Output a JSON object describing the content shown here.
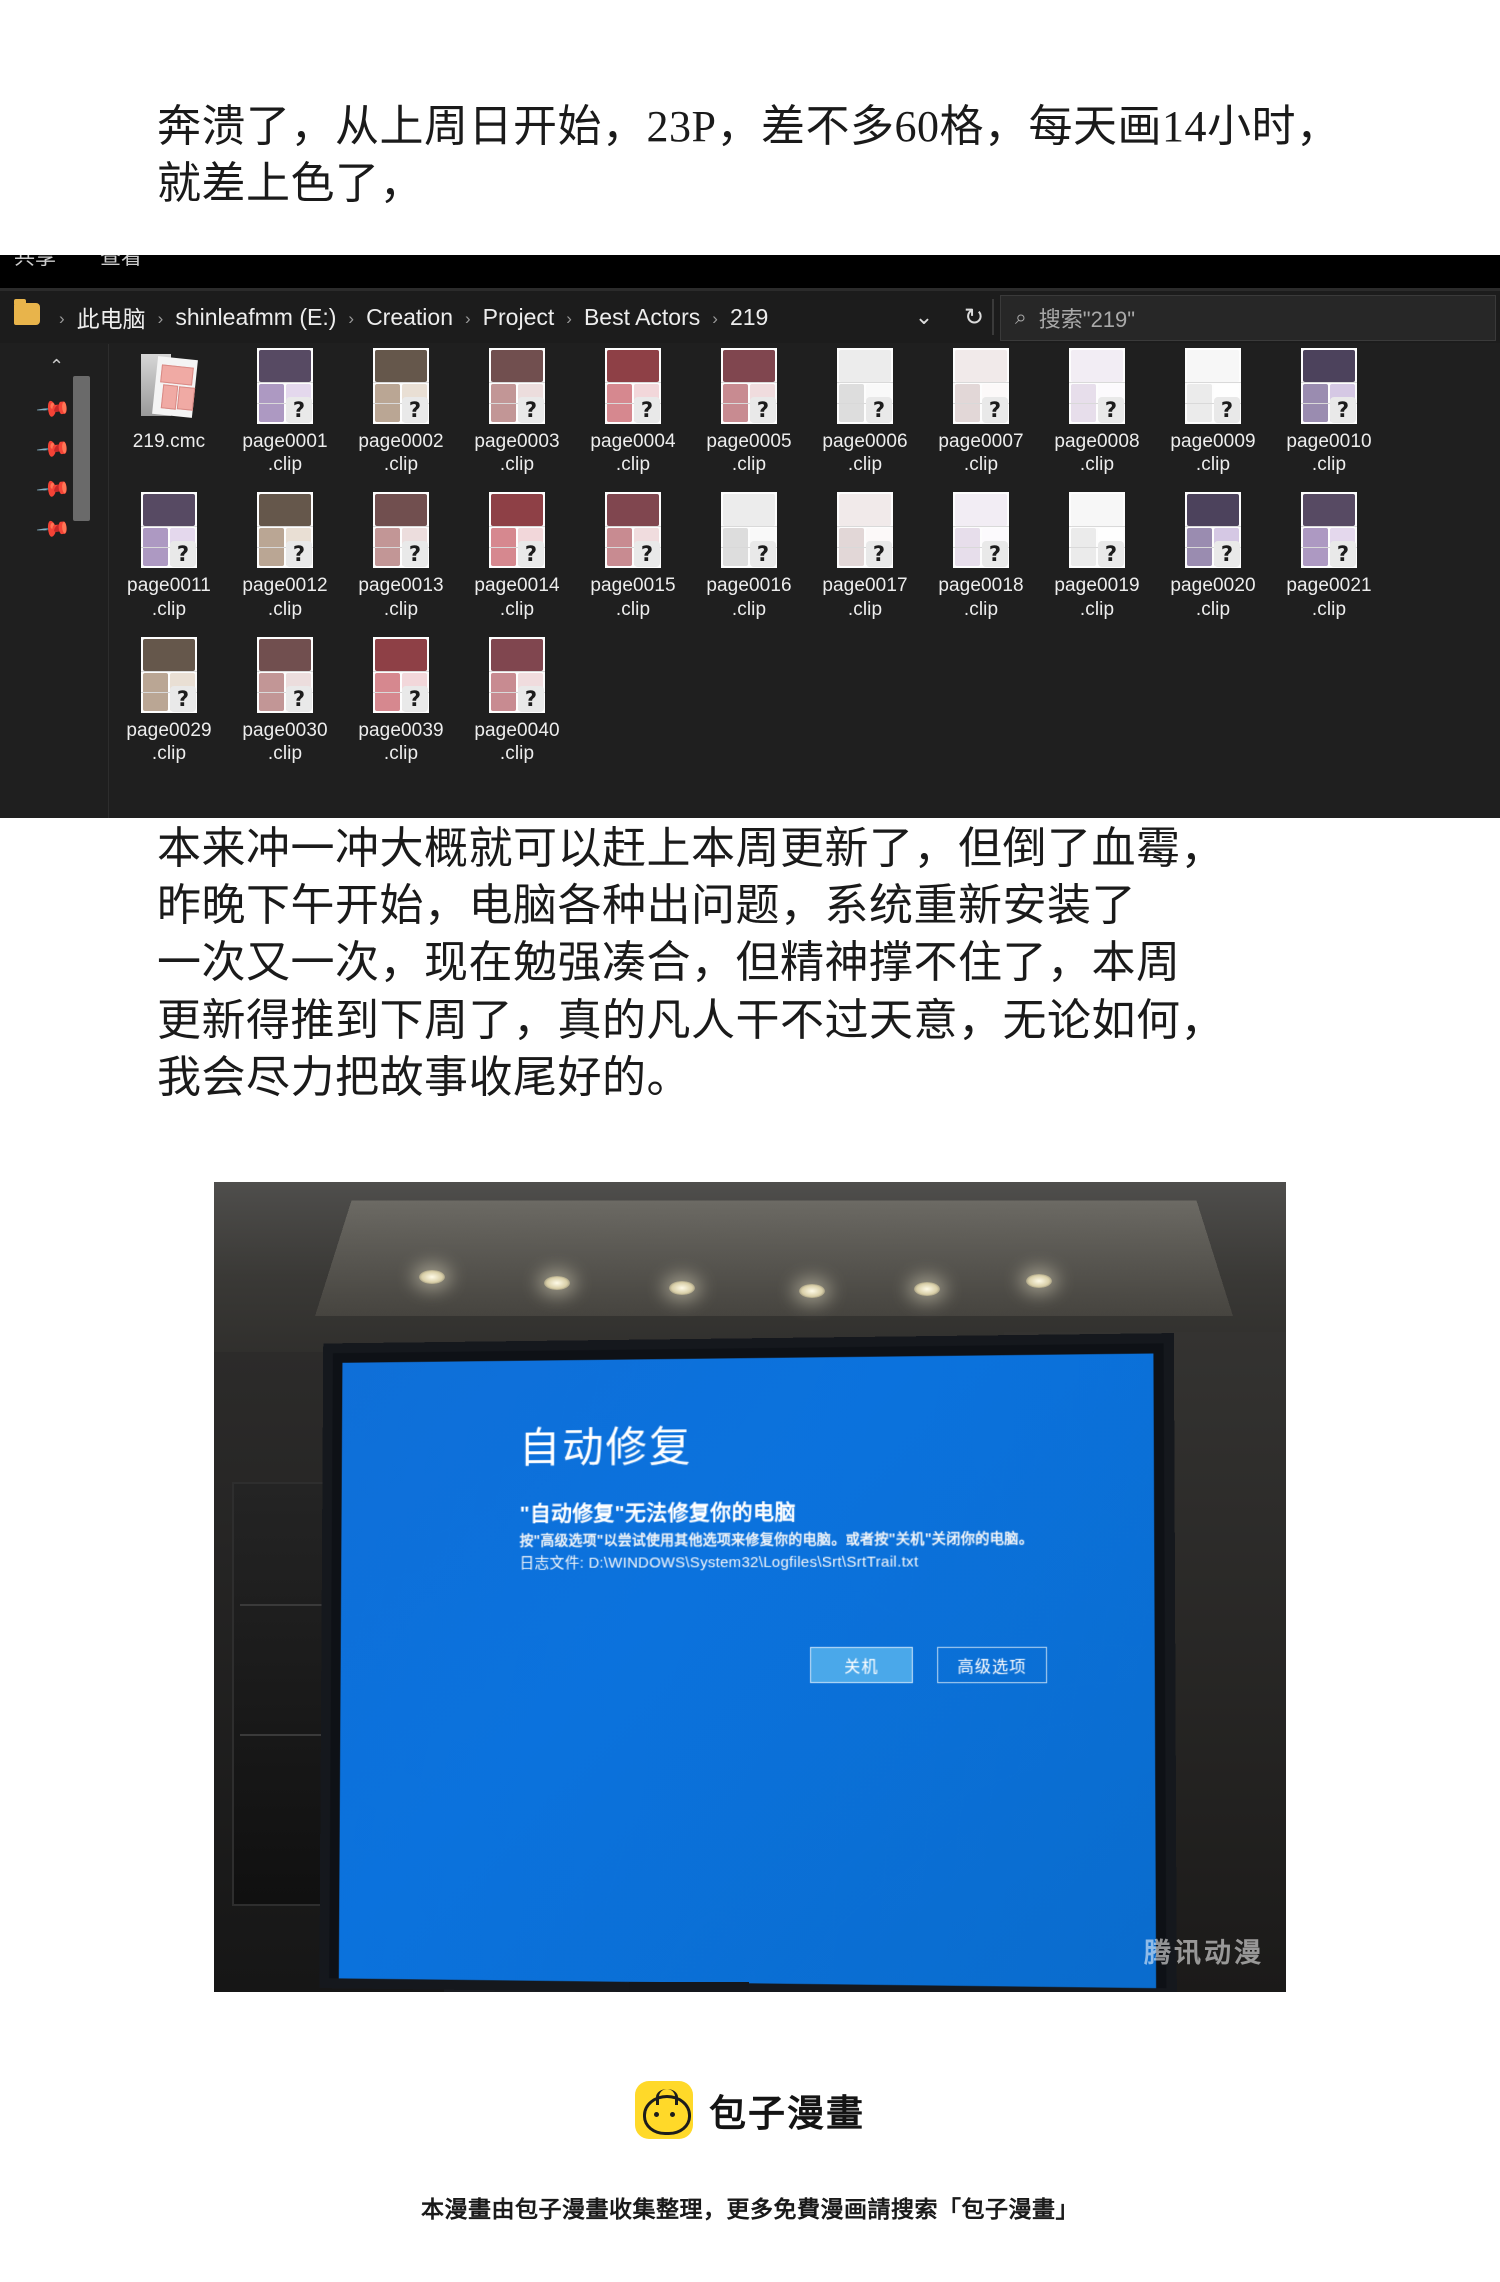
{
  "narration": {
    "top": "奔溃了，从上周日开始，23P，差不多60格，每天画14小时，\n就差上色了，",
    "middle": "本来冲一冲大概就可以赶上本周更新了，但倒了血霉，\n昨晚下午开始，电脑各种出问题，系统重新安装了\n一次又一次，现在勉强凑合，但精神撑不住了，本周\n更新得推到下周了，真的凡人干不过天意，无论如何，\n我会尽力把故事收尾好的。"
  },
  "explorer": {
    "ribbon_tabs": [
      "共享",
      "查看"
    ],
    "breadcrumb": [
      "此电脑",
      "shinleafmm (E:)",
      "Creation",
      "Project",
      "Best Actors",
      "219"
    ],
    "separator": "›",
    "history_icon": "chevron-down-icon",
    "refresh_icon": "refresh-icon",
    "search": {
      "icon": "search-icon",
      "placeholder": "搜索\"219\"",
      "value": ""
    },
    "rail": {
      "collapse_icon": "chevron-up-icon",
      "pins": [
        "pin-icon",
        "pin-icon",
        "pin-icon",
        "pin-icon"
      ]
    },
    "files": [
      {
        "name": "219.cmc",
        "type": "cmc"
      },
      {
        "name": "page0001\n.clip",
        "type": "clip"
      },
      {
        "name": "page0002\n.clip",
        "type": "clip"
      },
      {
        "name": "page0003\n.clip",
        "type": "clip"
      },
      {
        "name": "page0004\n.clip",
        "type": "clip"
      },
      {
        "name": "page0005\n.clip",
        "type": "clip"
      },
      {
        "name": "page0006\n.clip",
        "type": "clip"
      },
      {
        "name": "page0007\n.clip",
        "type": "clip"
      },
      {
        "name": "page0008\n.clip",
        "type": "clip"
      },
      {
        "name": "page0009\n.clip",
        "type": "clip"
      },
      {
        "name": "page0010\n.clip",
        "type": "clip"
      },
      {
        "name": "page0011\n.clip",
        "type": "clip"
      },
      {
        "name": "page0012\n.clip",
        "type": "clip"
      },
      {
        "name": "page0013\n.clip",
        "type": "clip"
      },
      {
        "name": "page0014\n.clip",
        "type": "clip"
      },
      {
        "name": "page0015\n.clip",
        "type": "clip"
      },
      {
        "name": "page0016\n.clip",
        "type": "clip"
      },
      {
        "name": "page0017\n.clip",
        "type": "clip"
      },
      {
        "name": "page0018\n.clip",
        "type": "clip"
      },
      {
        "name": "page0019\n.clip",
        "type": "clip"
      },
      {
        "name": "page0020\n.clip",
        "type": "clip"
      },
      {
        "name": "page0021\n.clip",
        "type": "clip"
      },
      {
        "name": "page0029\n.clip",
        "type": "clip"
      },
      {
        "name": "page0030\n.clip",
        "type": "clip"
      },
      {
        "name": "page0039\n.clip",
        "type": "clip"
      },
      {
        "name": "page0040\n.clip",
        "type": "clip"
      }
    ],
    "file_badge_glyph": "?"
  },
  "photo": {
    "bluescreen": {
      "title": "自动修复",
      "subtitle": "\"自动修复\"无法修复你的电脑",
      "hint": "按\"高级选项\"以尝试使用其他选项来修复你的电脑。或者按\"关机\"关闭你的电脑。",
      "logfile": "日志文件: D:\\WINDOWS\\System32\\Logfiles\\Srt\\SrtTrail.txt",
      "buttons": {
        "shutdown": "关机",
        "advanced": "高级选项"
      },
      "bg_color": "#0b72dd"
    },
    "watermark": "腾讯动漫"
  },
  "footer": {
    "brand_name": "包子漫畫",
    "brand_color": "#ffd929",
    "note": "本漫畫由包子漫畫收集整理，更多免費漫画請搜索「包子漫畫」"
  }
}
